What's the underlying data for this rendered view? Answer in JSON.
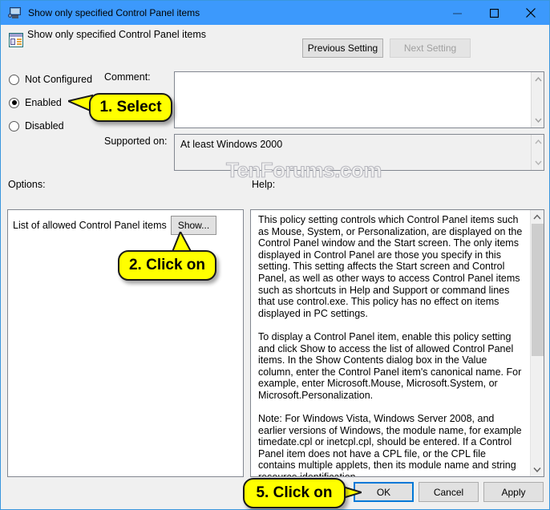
{
  "window": {
    "title": "Show only specified Control Panel items",
    "icon": "control-panel-monitor-icon",
    "minimize_label": "Minimize",
    "maximize_label": "Maximize",
    "close_label": "Close",
    "titlebar_color": "#3c99fc",
    "border_color": "#3a96dd"
  },
  "header": {
    "policy_title": "Show only specified Control Panel items",
    "icon": "policy-setting-icon",
    "previous_setting_label": "Previous Setting",
    "next_setting_label": "Next Setting",
    "next_setting_disabled": true
  },
  "state": {
    "options": [
      {
        "label": "Not Configured",
        "selected": false
      },
      {
        "label": "Enabled",
        "selected": true
      },
      {
        "label": "Disabled",
        "selected": false
      }
    ]
  },
  "comment": {
    "label": "Comment:",
    "value": ""
  },
  "supported": {
    "label": "Supported on:",
    "value": "At least Windows 2000"
  },
  "panels": {
    "options_label": "Options:",
    "help_label": "Help:"
  },
  "options_panel": {
    "item_label": "List of allowed Control Panel items",
    "show_button_label": "Show..."
  },
  "help_panel": {
    "text": "This policy setting controls which Control Panel items such as Mouse, System, or Personalization, are displayed on the Control Panel window and the Start screen. The only items displayed in Control Panel are those you specify in this setting. This setting affects the Start screen and Control Panel, as well as other ways to access Control Panel items such as shortcuts in Help and Support or command lines that use control.exe. This policy has no effect on items displayed in PC settings.\n\nTo display a Control Panel item, enable this policy setting and click Show to access the list of allowed Control Panel items. In the Show Contents dialog box in the Value column, enter the Control Panel item's canonical name. For example, enter Microsoft.Mouse, Microsoft.System, or Microsoft.Personalization.\n\nNote: For Windows Vista, Windows Server 2008, and earlier versions of Windows, the module name, for example timedate.cpl or inetcpl.cpl, should be entered. If a Control Panel item does not have a CPL file, or the CPL file contains multiple applets, then its module name and string resource identification"
  },
  "footer": {
    "ok_label": "OK",
    "cancel_label": "Cancel",
    "apply_label": "Apply",
    "focus_color": "#0078d7"
  },
  "watermark": {
    "text": "TenForums.com"
  },
  "callouts": [
    {
      "text": "1. Select"
    },
    {
      "text": "2. Click on"
    },
    {
      "text": "5. Click on"
    }
  ]
}
